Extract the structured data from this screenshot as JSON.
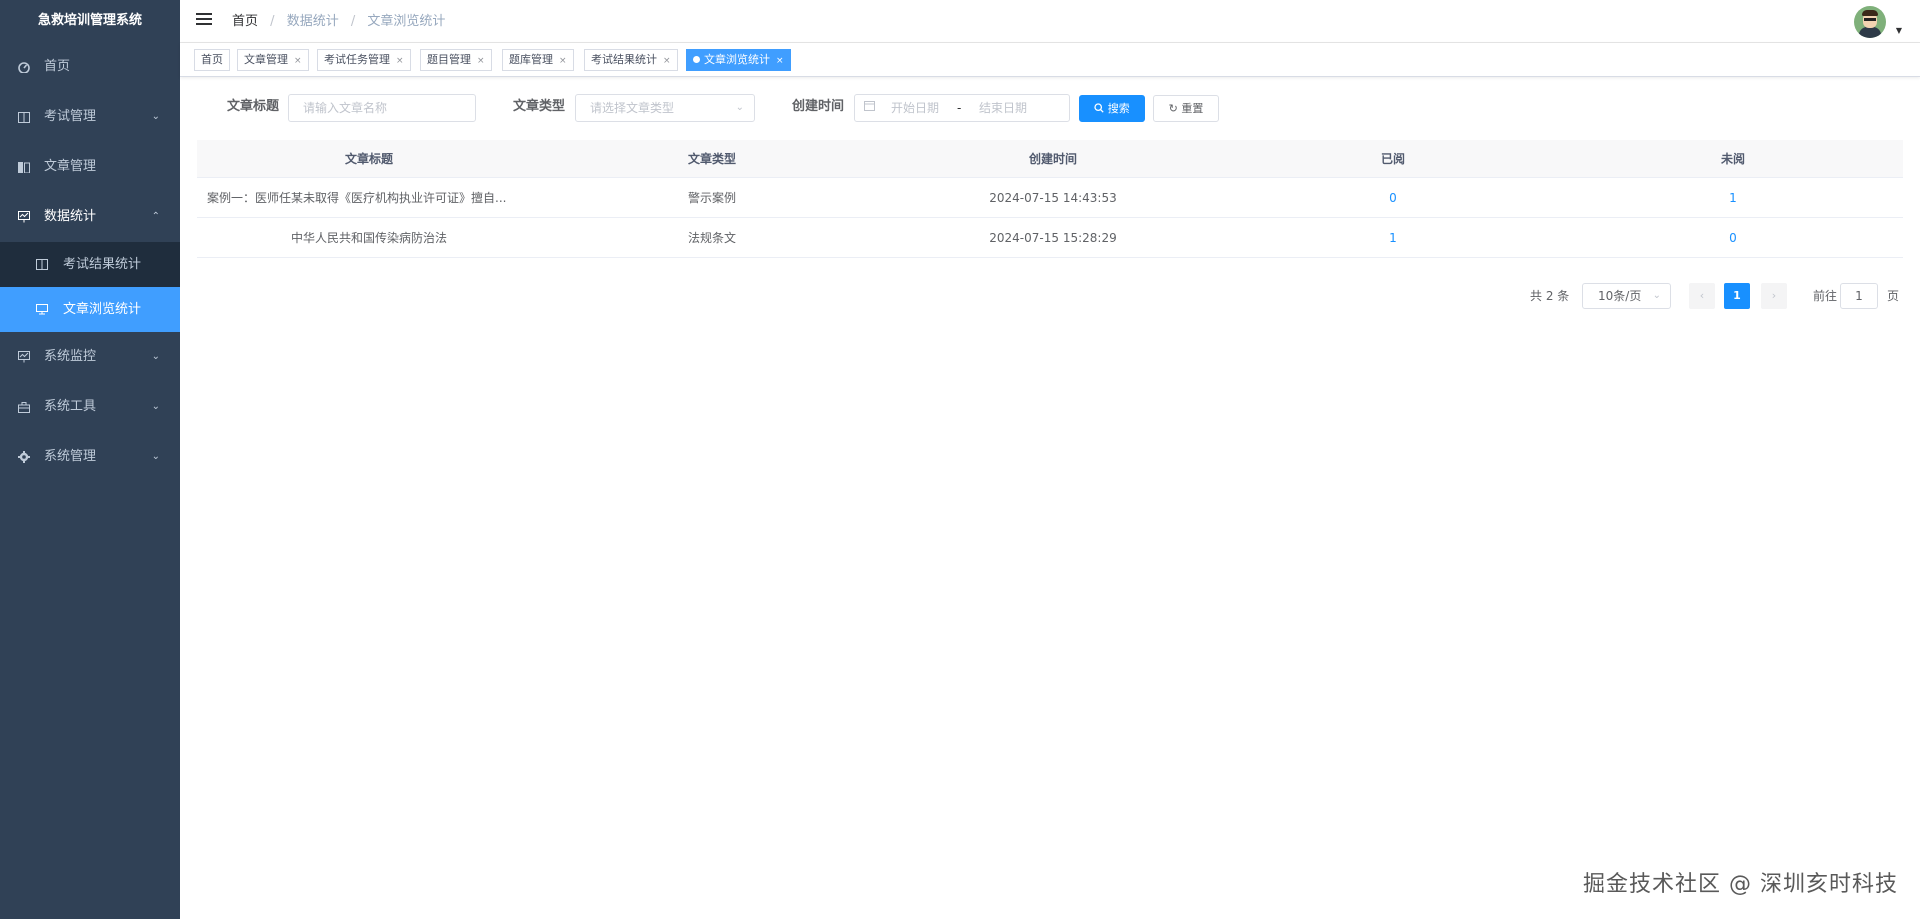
{
  "app": {
    "title": "急救培训管理系统"
  },
  "sidebar": {
    "items": [
      {
        "label": "首页",
        "icon": "dashboard-icon"
      },
      {
        "label": "考试管理",
        "icon": "columns-icon"
      },
      {
        "label": "文章管理",
        "icon": "book-icon"
      },
      {
        "label": "数据统计",
        "icon": "chart-icon"
      },
      {
        "label": "系统监控",
        "icon": "monitor-icon"
      },
      {
        "label": "系统工具",
        "icon": "toolbox-icon"
      },
      {
        "label": "系统管理",
        "icon": "gear-icon"
      }
    ],
    "sub_items": [
      {
        "label": "考试结果统计",
        "icon": "columns-icon"
      },
      {
        "label": "文章浏览统计",
        "icon": "screen-icon"
      }
    ]
  },
  "navbar": {
    "breadcrumb": [
      "首页",
      "数据统计",
      "文章浏览统计"
    ]
  },
  "tags": [
    {
      "label": "首页"
    },
    {
      "label": "文章管理"
    },
    {
      "label": "考试任务管理"
    },
    {
      "label": "题目管理"
    },
    {
      "label": "题库管理"
    },
    {
      "label": "考试结果统计"
    },
    {
      "label": "文章浏览统计"
    }
  ],
  "filters": {
    "title_label": "文章标题",
    "title_placeholder": "请输入文章名称",
    "type_label": "文章类型",
    "type_placeholder": "请选择文章类型",
    "time_label": "创建时间",
    "start_placeholder": "开始日期",
    "range_separator": "-",
    "end_placeholder": "结束日期",
    "search_label": "搜索",
    "reset_label": "重置"
  },
  "table": {
    "columns": [
      "文章标题",
      "文章类型",
      "创建时间",
      "已阅",
      "未阅"
    ],
    "rows": [
      [
        "案例一：医师任某未取得《医疗机构执业许可证》擅自...",
        "警示案例",
        "2024-07-15 14:43:53",
        "0",
        "1"
      ],
      [
        "中华人民共和国传染病防治法",
        "法规条文",
        "2024-07-15 15:28:29",
        "1",
        "0"
      ]
    ]
  },
  "pagination": {
    "total": "共 2 条",
    "page_size": "10条/页",
    "current": "1",
    "goto_label": "前往",
    "goto_value": "1",
    "page_suffix": "页"
  },
  "watermark": "掘金技术社区 @ 深圳亥时科技",
  "colors": {
    "sidebar_bg": "#304156",
    "submenu_bg": "#1f2d3d",
    "accent": "#1890ff",
    "active_menu": "#409eff"
  }
}
